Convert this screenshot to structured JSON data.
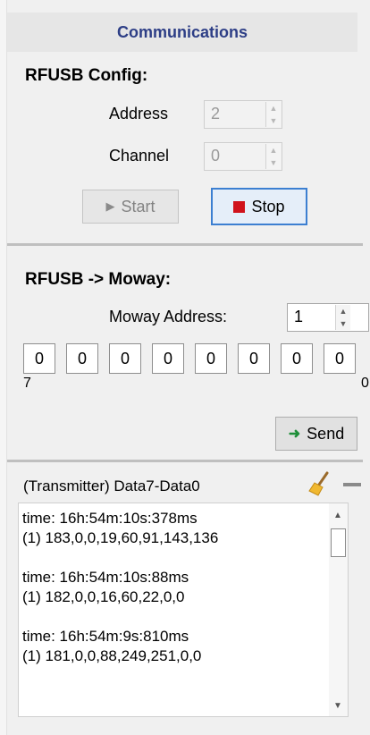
{
  "header": {
    "title": "Communications"
  },
  "rfusb_config": {
    "title": "RFUSB Config:",
    "address_label": "Address",
    "address_value": "2",
    "channel_label": "Channel",
    "channel_value": "0",
    "start_label": "Start",
    "stop_label": "Stop"
  },
  "rfusb_moway": {
    "title": "RFUSB -> Moway:",
    "moway_address_label": "Moway Address:",
    "moway_address_value": "1",
    "bits": [
      "0",
      "0",
      "0",
      "0",
      "0",
      "0",
      "0",
      "0"
    ],
    "bit_high_label": "7",
    "bit_low_label": "0",
    "send_label": "Send"
  },
  "log": {
    "title": "(Transmitter) Data7-Data0",
    "text": "time: 16h:54m:10s:378ms\n(1) 183,0,0,19,60,91,143,136\n\ntime: 16h:54m:10s:88ms\n(1) 182,0,0,16,60,22,0,0\n\ntime: 16h:54m:9s:810ms\n(1) 181,0,0,88,249,251,0,0"
  },
  "icons": {
    "play": "play-icon",
    "stop": "stop-icon",
    "send": "arrow-right-icon",
    "broom": "broom-icon",
    "minimize": "minimize-icon"
  },
  "colors": {
    "header_text": "#2d3e86",
    "stop_red": "#d0121b",
    "send_green": "#1f8f3a",
    "focus_blue": "#3c7fd1"
  }
}
